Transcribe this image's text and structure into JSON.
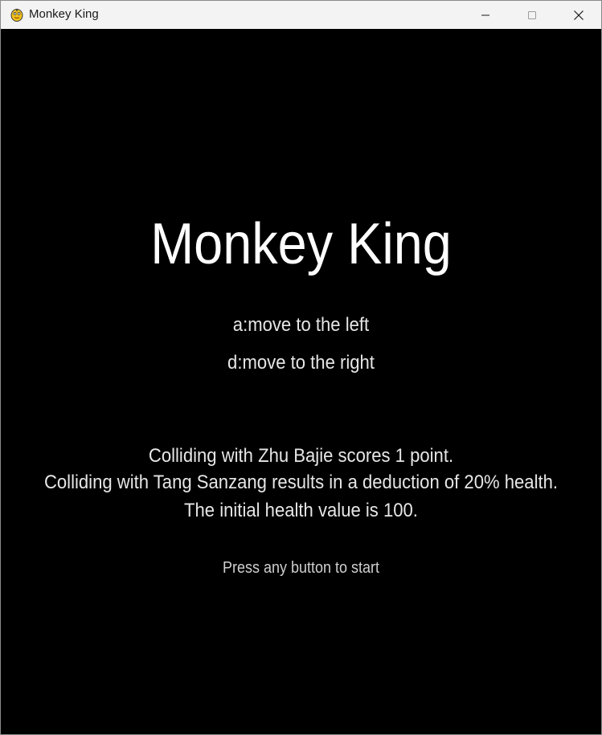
{
  "window": {
    "title": "Monkey King",
    "app_icon": "pygame-snake-icon",
    "controls": [
      "minimize-icon",
      "maximize-icon",
      "close-icon"
    ]
  },
  "game": {
    "title": "Monkey King",
    "controls": {
      "left": "a:move to the left",
      "right": "d:move to the right"
    },
    "rules": [
      "Colliding with Zhu Bajie scores 1 point.",
      "Colliding with Tang Sanzang results in a deduction of 20% health.",
      "The initial health value is 100."
    ],
    "start_prompt": "Press any button to start"
  },
  "colors": {
    "background": "#000000",
    "text": "#ffffff",
    "titlebar": "#f3f3f3"
  }
}
